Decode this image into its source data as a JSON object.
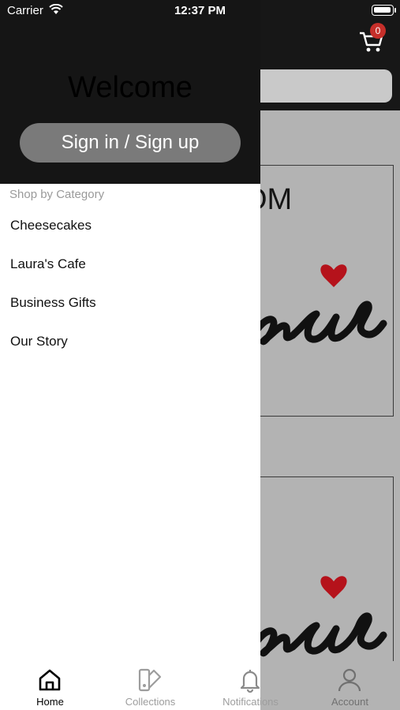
{
  "status_bar": {
    "carrier": "Carrier",
    "time": "12:37 PM"
  },
  "header": {
    "cart_count": "0"
  },
  "background": {
    "card_text": "OM"
  },
  "drawer": {
    "welcome": "Welcome",
    "sign_in_label": "Sign in / Sign up",
    "category_heading": "Shop by Category",
    "items": [
      {
        "label": "Cheesecakes"
      },
      {
        "label": "Laura's Cafe"
      },
      {
        "label": "Business Gifts"
      },
      {
        "label": "Our Story"
      }
    ]
  },
  "tabs": [
    {
      "label": "Home",
      "icon": "home-icon",
      "active": true
    },
    {
      "label": "Collections",
      "icon": "collections-icon",
      "active": false
    },
    {
      "label": "Notifications",
      "icon": "bell-icon",
      "active": false
    },
    {
      "label": "Account",
      "icon": "user-icon",
      "active": false
    }
  ],
  "colors": {
    "drawer_header": "#151515",
    "badge": "#c62f2a",
    "heart": "#b5121b",
    "sign_in_button": "#7a7a7a"
  }
}
